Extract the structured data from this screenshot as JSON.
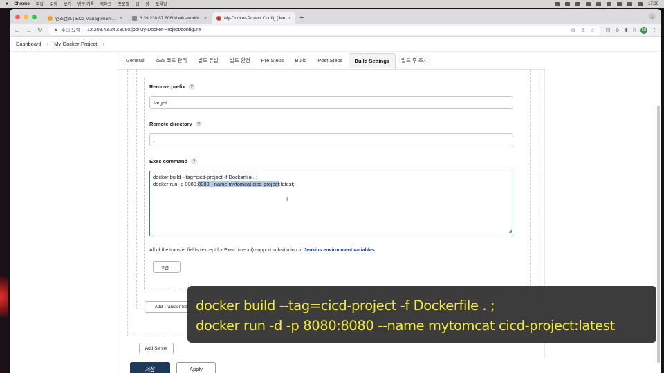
{
  "menubar": {
    "app": "Chrome",
    "items": [
      "파일",
      "수정",
      "보기",
      "방문 기록",
      "북마크",
      "프로필",
      "탭",
      "창",
      "도움말"
    ],
    "time": "17:36"
  },
  "tabs": [
    {
      "label": "인스턴스 | EC2 Management Co",
      "favicon_color": "#f0a020",
      "active": false
    },
    {
      "label": "3.39.230.87:8080/hello-world/",
      "favicon_color": "#888888",
      "active": false
    },
    {
      "label": "My-Docker-Project Config [Jen",
      "favicon_color": "#c04030",
      "active": true
    }
  ],
  "address": {
    "warning": "주의 요함",
    "url": "13.209.43.242:8080/job/My-Docker-Project/configure",
    "avatar": "SR"
  },
  "breadcrumb": {
    "items": [
      "Dashboard",
      "My-Docker-Project"
    ]
  },
  "config_tabs": [
    {
      "label": "General",
      "active": false
    },
    {
      "label": "소스 코드 관리",
      "active": false
    },
    {
      "label": "빌드 유발",
      "active": false
    },
    {
      "label": "빌드 환경",
      "active": false
    },
    {
      "label": "Pre Steps",
      "active": false
    },
    {
      "label": "Build",
      "active": false
    },
    {
      "label": "Post Steps",
      "active": false
    },
    {
      "label": "Build Settings",
      "active": true
    },
    {
      "label": "빌드 후 조치",
      "active": false
    }
  ],
  "form": {
    "remove_prefix_label": "Remove prefix",
    "remove_prefix_value": "target",
    "remote_directory_label": "Remote directory",
    "remote_directory_value": ".",
    "exec_command_label": "Exec command",
    "exec_line1": "docker build --tag=cicd-project -f Dockerfile . ;",
    "exec_line2_pre": "docker run -p 8080:",
    "exec_line2_hl": "8080 --name mytomcat cicd-project",
    "exec_line2_post": ":latest;",
    "help": "?",
    "helptext_pre": "All of the transfer fields (except for Exec timeout) support substitution of ",
    "helptext_link": "Jenkins environment variables",
    "advanced_button": "고급...",
    "add_transfer_set": "Add Transfer Set",
    "add_server": "Add Server"
  },
  "footer": {
    "save": "저장",
    "apply": "Apply"
  },
  "overlay": {
    "line1": "docker build --tag=cicd-project -f Dockerfile . ;",
    "line2": "docker run -d -p 8080:8080 --name mytomcat cicd-project:latest"
  },
  "colors": {
    "accent": "#3e78b2",
    "save_bg": "#1e3a5a",
    "overlay_text": "#f2ea3a"
  }
}
